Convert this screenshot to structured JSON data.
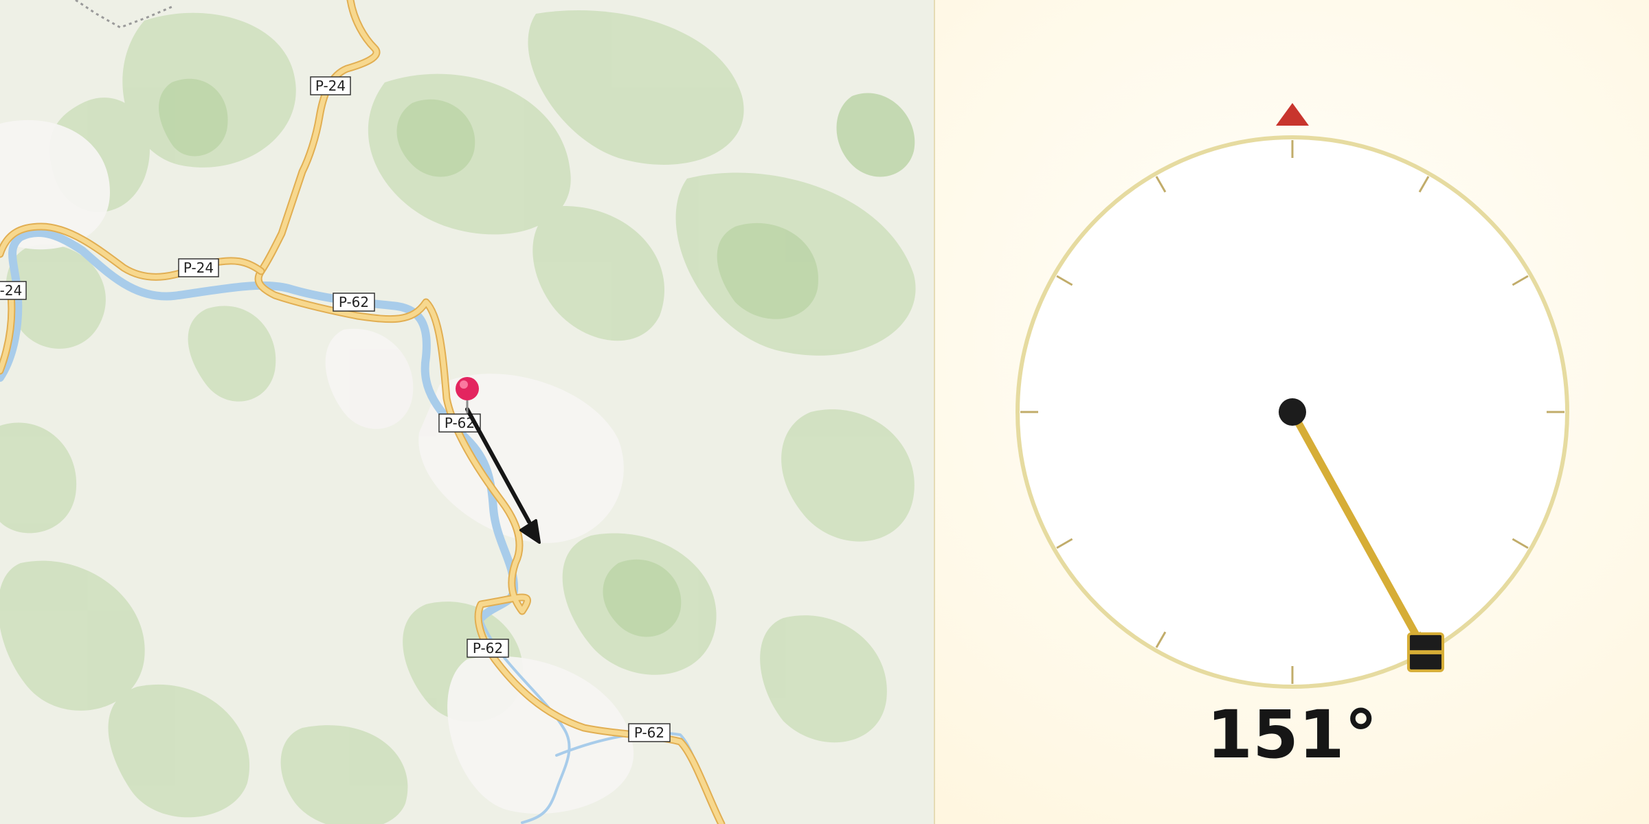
{
  "map": {
    "road_labels": [
      "P-24",
      "P-24",
      "-24",
      "P-62",
      "P-62",
      "P-62",
      "P-62"
    ],
    "marker_icon": "map-pin-icon",
    "direction_arrow_icon": "arrow-icon",
    "colors": {
      "land": "#eef0e6",
      "forest": "#cfe0bf",
      "forest_dark": "#bcd5a8",
      "urban": "#f3f1f0",
      "road": "#f4cf7c",
      "road_border": "#e1ae52",
      "river": "#a8ccea",
      "pin": "#e3255f"
    }
  },
  "compass": {
    "heading_degrees": 151,
    "heading_text": "151°",
    "north_marker_icon": "north-triangle-icon",
    "needle_handle_icon": "drag-handle-icon",
    "colors": {
      "dial_fill": "#ffffff",
      "dial_ring": "#e6dba0",
      "tick": "#c1ac6a",
      "needle": "#d6ad36",
      "north": "#c8352d",
      "hub": "#1c1c1c"
    }
  }
}
